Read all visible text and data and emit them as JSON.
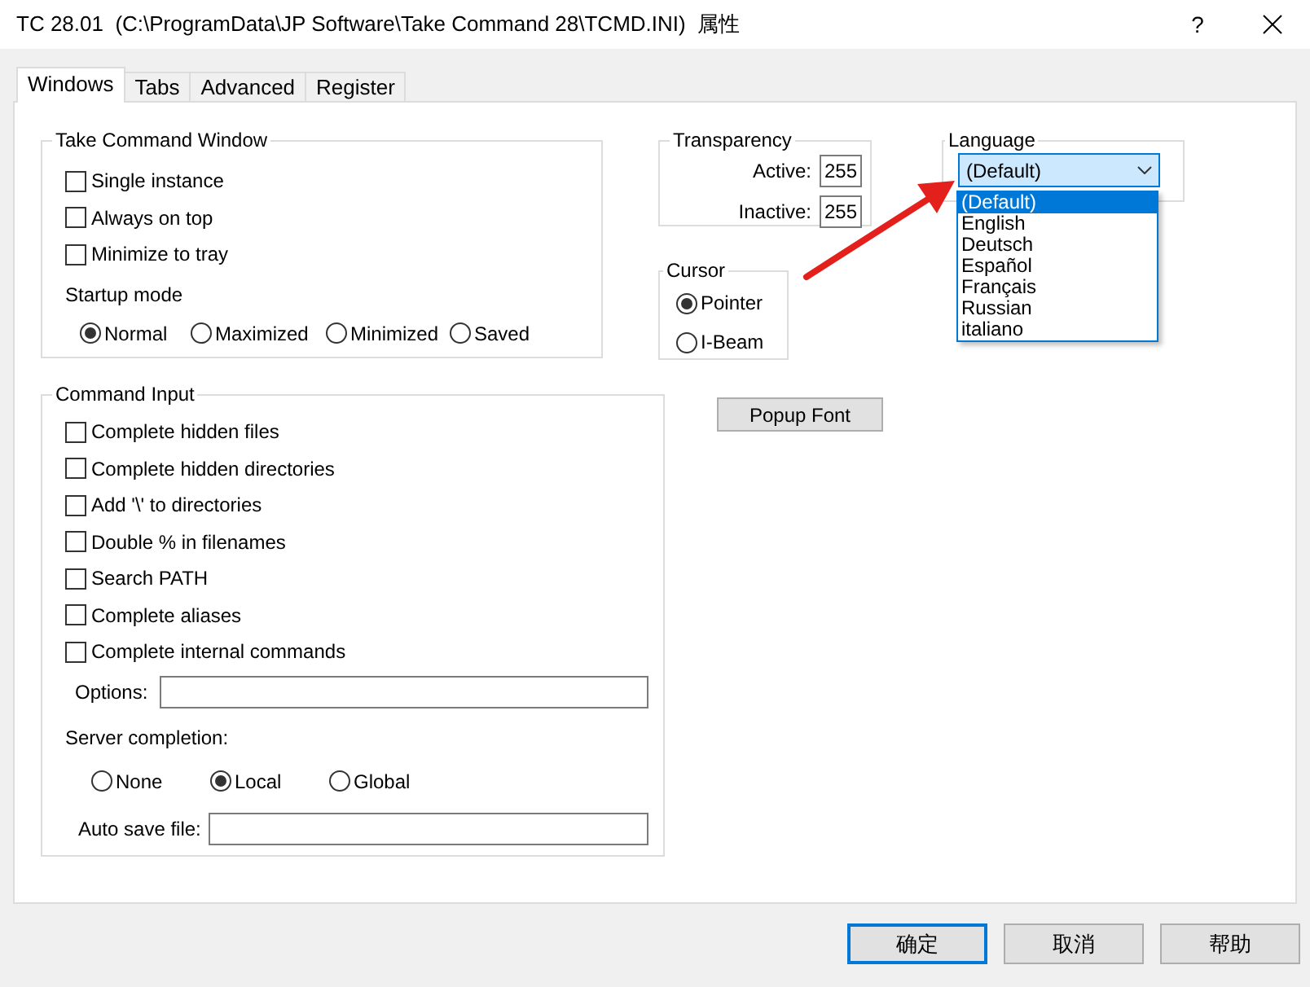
{
  "window": {
    "title": "TC 28.01  (C:\\ProgramData\\JP Software\\Take Command 28\\TCMD.INI)  属性",
    "help_button": "?"
  },
  "tabs": [
    {
      "label": "Windows",
      "selected": true
    },
    {
      "label": "Tabs",
      "selected": false
    },
    {
      "label": "Advanced",
      "selected": false
    },
    {
      "label": "Register",
      "selected": false
    }
  ],
  "take_command_window": {
    "title": "Take Command Window",
    "checkboxes": [
      {
        "label": "Single instance",
        "checked": false
      },
      {
        "label": "Always on top",
        "checked": false
      },
      {
        "label": "Minimize to tray",
        "checked": false
      }
    ],
    "startup_mode": {
      "label": "Startup mode",
      "options": [
        {
          "label": "Normal",
          "selected": true
        },
        {
          "label": "Maximized",
          "selected": false
        },
        {
          "label": "Minimized",
          "selected": false
        },
        {
          "label": "Saved",
          "selected": false
        }
      ]
    }
  },
  "transparency": {
    "title": "Transparency",
    "fields": [
      {
        "label": "Active:",
        "value": "255"
      },
      {
        "label": "Inactive:",
        "value": "255"
      }
    ]
  },
  "cursor": {
    "title": "Cursor",
    "options": [
      {
        "label": "Pointer",
        "selected": true
      },
      {
        "label": "I-Beam",
        "selected": false
      }
    ]
  },
  "language": {
    "title": "Language",
    "value": "(Default)",
    "expanded": true,
    "options": [
      {
        "label": "(Default)",
        "selected": true
      },
      {
        "label": "English",
        "selected": false
      },
      {
        "label": "Deutsch",
        "selected": false
      },
      {
        "label": "Español",
        "selected": false
      },
      {
        "label": "Français",
        "selected": false
      },
      {
        "label": "Russian",
        "selected": false
      },
      {
        "label": "italiano",
        "selected": false
      }
    ]
  },
  "command_input": {
    "title": "Command Input",
    "checkboxes": [
      {
        "label": "Complete hidden files",
        "checked": false
      },
      {
        "label": "Complete hidden directories",
        "checked": false
      },
      {
        "label": "Add '\\' to directories",
        "checked": false
      },
      {
        "label": "Double % in filenames",
        "checked": false
      },
      {
        "label": "Search PATH",
        "checked": false
      },
      {
        "label": "Complete aliases",
        "checked": false
      },
      {
        "label": "Complete internal commands",
        "checked": false
      }
    ],
    "options_field": {
      "label": "Options:"
    },
    "server_completion": {
      "label": "Server completion:",
      "options": [
        {
          "label": "None",
          "selected": false
        },
        {
          "label": "Local",
          "selected": true
        },
        {
          "label": "Global",
          "selected": false
        }
      ]
    },
    "auto_save_field": {
      "label": "Auto save file:"
    }
  },
  "popup_font_button": "Popup Font",
  "footer_buttons": [
    {
      "label": "确定",
      "default": true
    },
    {
      "label": "取消",
      "default": false
    },
    {
      "label": "帮助",
      "default": false
    }
  ]
}
